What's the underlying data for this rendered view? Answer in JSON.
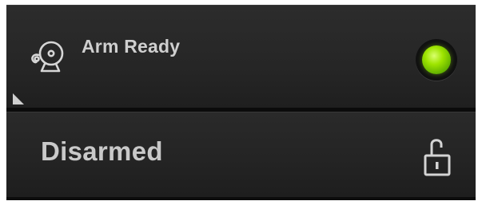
{
  "alarm_panel": {
    "arm_row": {
      "label": "Arm Ready",
      "icon": "bell-icon",
      "indicator": {
        "icon": "status-led",
        "state": "on",
        "color": "#8fd400"
      }
    },
    "status_row": {
      "label": "Disarmed",
      "icon": "unlocked-padlock-icon"
    }
  },
  "colors": {
    "panel_background": "#262626",
    "text": "#cfcfcf",
    "led_green": "#8fd400"
  }
}
